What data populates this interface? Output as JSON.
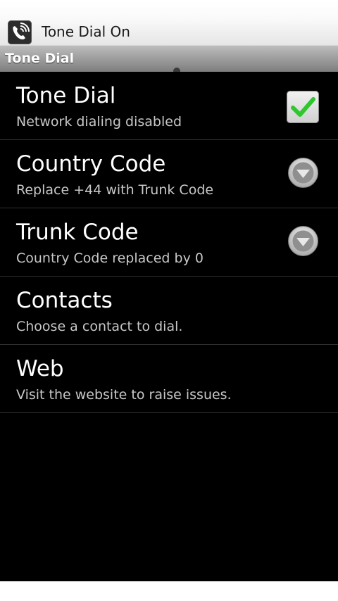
{
  "status_bar": {
    "notification_icon": "tone-dial-phone-icon",
    "notification_text": "Tone Dial On"
  },
  "title_bar": {
    "title": "Tone Dial"
  },
  "preferences": [
    {
      "title": "Tone Dial",
      "summary": "Network dialing disabled",
      "widget": "checkbox",
      "checked": true
    },
    {
      "title": "Country Code",
      "summary": "Replace +44 with Trunk Code",
      "widget": "dropdown"
    },
    {
      "title": "Trunk Code",
      "summary": "Country Code replaced by 0",
      "widget": "dropdown"
    },
    {
      "title": "Contacts",
      "summary": "Choose a contact to dial.",
      "widget": "none"
    },
    {
      "title": "Web",
      "summary": "Visit the website to raise issues.",
      "widget": "none"
    }
  ],
  "colors": {
    "background": "#000000",
    "checkmark": "#2fc62f",
    "title_bar": "#9d9d9d"
  }
}
